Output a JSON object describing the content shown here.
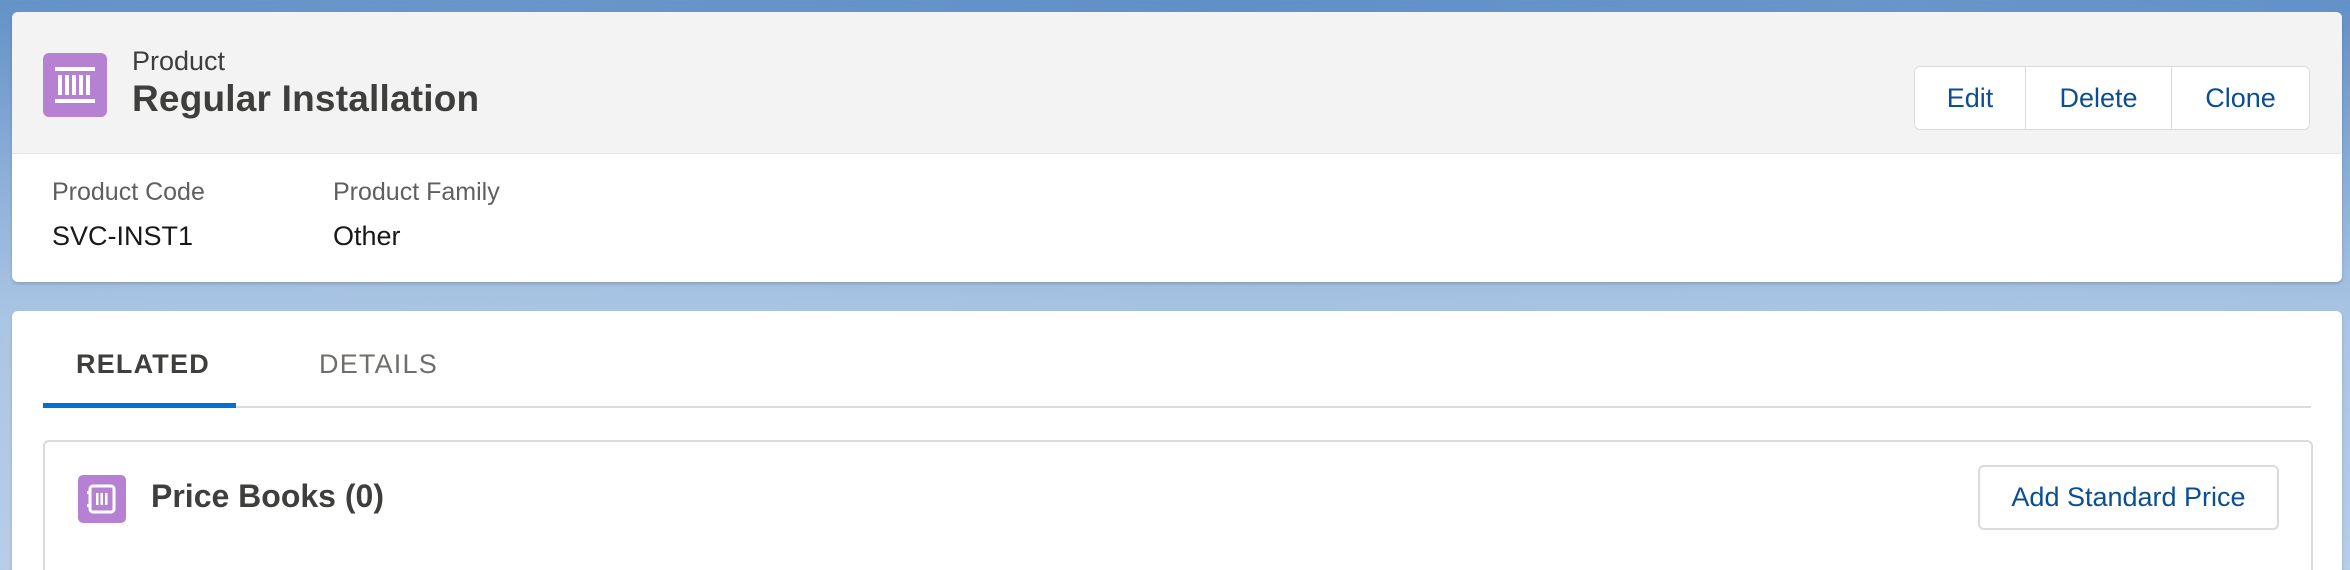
{
  "header": {
    "object_label": "Product",
    "record_title": "Regular Installation",
    "icon": "product-icon",
    "buttons": {
      "edit": "Edit",
      "delete": "Delete",
      "clone": "Clone"
    },
    "highlights": [
      {
        "label": "Product Code",
        "value": "SVC-INST1"
      },
      {
        "label": "Product Family",
        "value": "Other"
      }
    ]
  },
  "tabs": [
    {
      "label": "RELATED",
      "active": true
    },
    {
      "label": "DETAILS",
      "active": false
    }
  ],
  "related": {
    "price_books": {
      "icon": "pricebook-icon",
      "title": "Price Books (0)",
      "action": "Add Standard Price"
    }
  },
  "colors": {
    "accent": "#0070d2",
    "product_icon_bg": "#b781d3",
    "link": "#0b4e91"
  }
}
